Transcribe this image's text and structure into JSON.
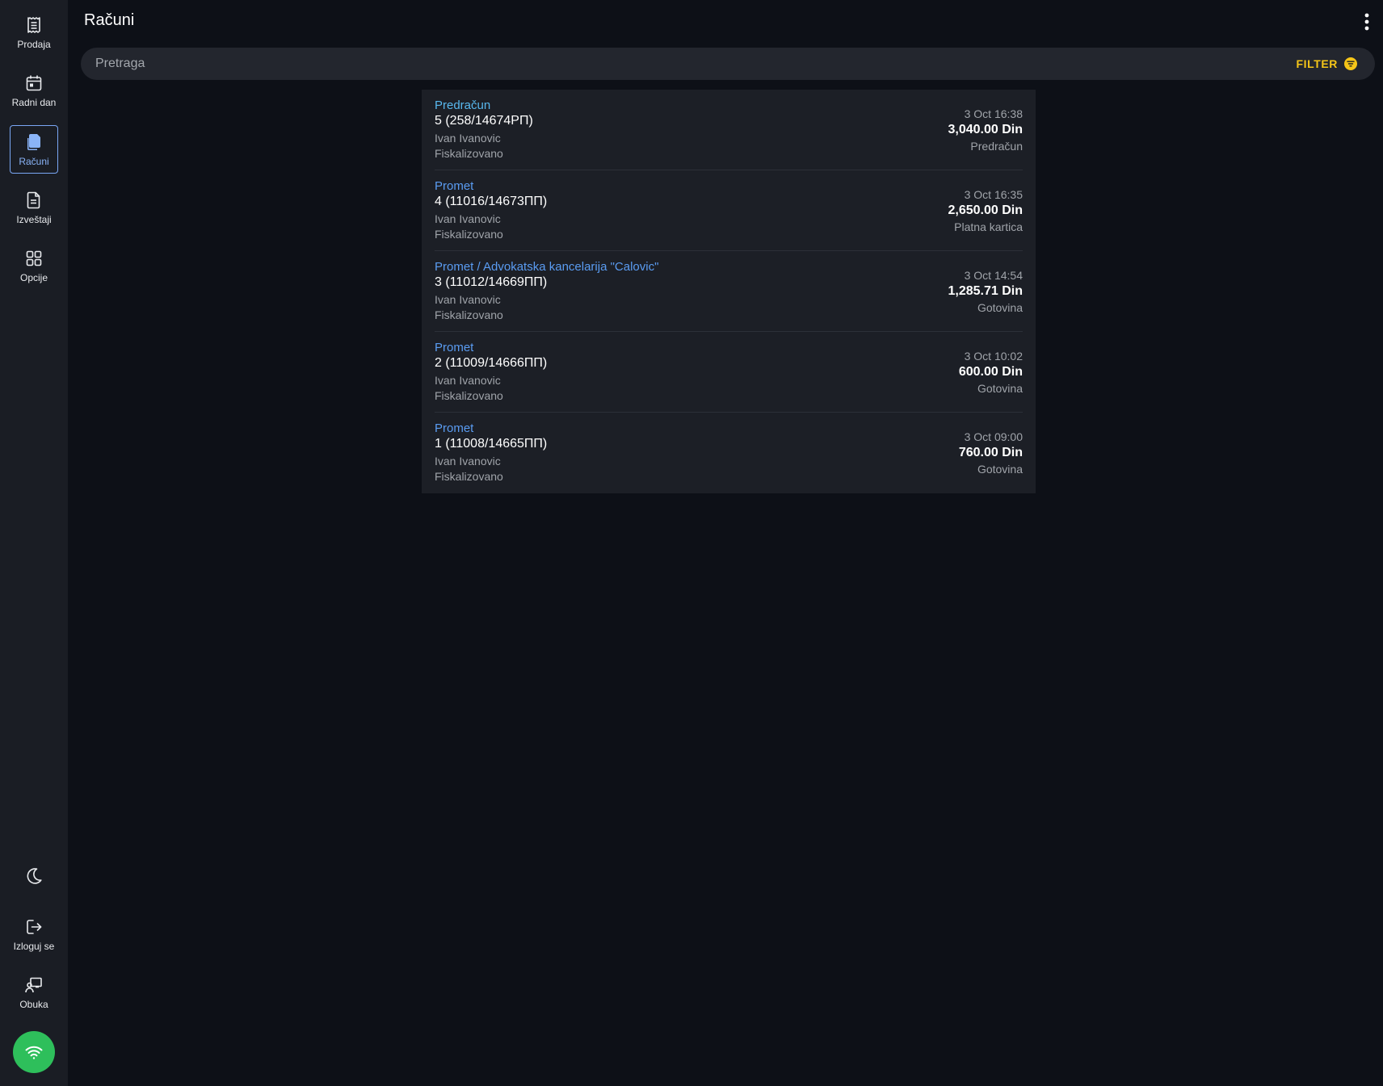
{
  "sidebar": {
    "items": [
      {
        "label": "Prodaja",
        "icon": "receipt-icon"
      },
      {
        "label": "Radni dan",
        "icon": "calendar-icon"
      },
      {
        "label": "Računi",
        "icon": "documents-icon",
        "active": true
      },
      {
        "label": "Izveštaji",
        "icon": "report-icon"
      },
      {
        "label": "Opcije",
        "icon": "grid-icon"
      }
    ],
    "bottom": {
      "theme_icon": "moon-icon",
      "logout_label": "Izloguj se",
      "training_label": "Obuka",
      "connection_icon": "wifi-icon"
    }
  },
  "header": {
    "title": "Računi"
  },
  "search": {
    "placeholder": "Pretraga",
    "value": "",
    "filter_label": "FILTER"
  },
  "colors": {
    "accent_blue": "#5a9cf2",
    "filter_yellow": "#f5c518",
    "online_green": "#2ebf5b"
  },
  "receipts": [
    {
      "type": "Predračun",
      "number": "5 (258/14674РП)",
      "user": "Ivan Ivanovic",
      "status": "Fiskalizovano",
      "date": "3 Oct 16:38",
      "amount": "3,040.00 Din",
      "payment": "Predračun"
    },
    {
      "type": "Promet",
      "number": "4 (11016/14673ПП)",
      "user": "Ivan Ivanovic",
      "status": "Fiskalizovano",
      "date": "3 Oct 16:35",
      "amount": "2,650.00 Din",
      "payment": "Platna kartica"
    },
    {
      "type": "Promet / Advokatska kancelarija \"Calovic\"",
      "number": "3 (11012/14669ПП)",
      "user": "Ivan Ivanovic",
      "status": "Fiskalizovano",
      "date": "3 Oct 14:54",
      "amount": "1,285.71 Din",
      "payment": "Gotovina"
    },
    {
      "type": "Promet",
      "number": "2 (11009/14666ПП)",
      "user": "Ivan Ivanovic",
      "status": "Fiskalizovano",
      "date": "3 Oct 10:02",
      "amount": "600.00 Din",
      "payment": "Gotovina"
    },
    {
      "type": "Promet",
      "number": "1 (11008/14665ПП)",
      "user": "Ivan Ivanovic",
      "status": "Fiskalizovano",
      "date": "3 Oct 09:00",
      "amount": "760.00 Din",
      "payment": "Gotovina"
    }
  ]
}
